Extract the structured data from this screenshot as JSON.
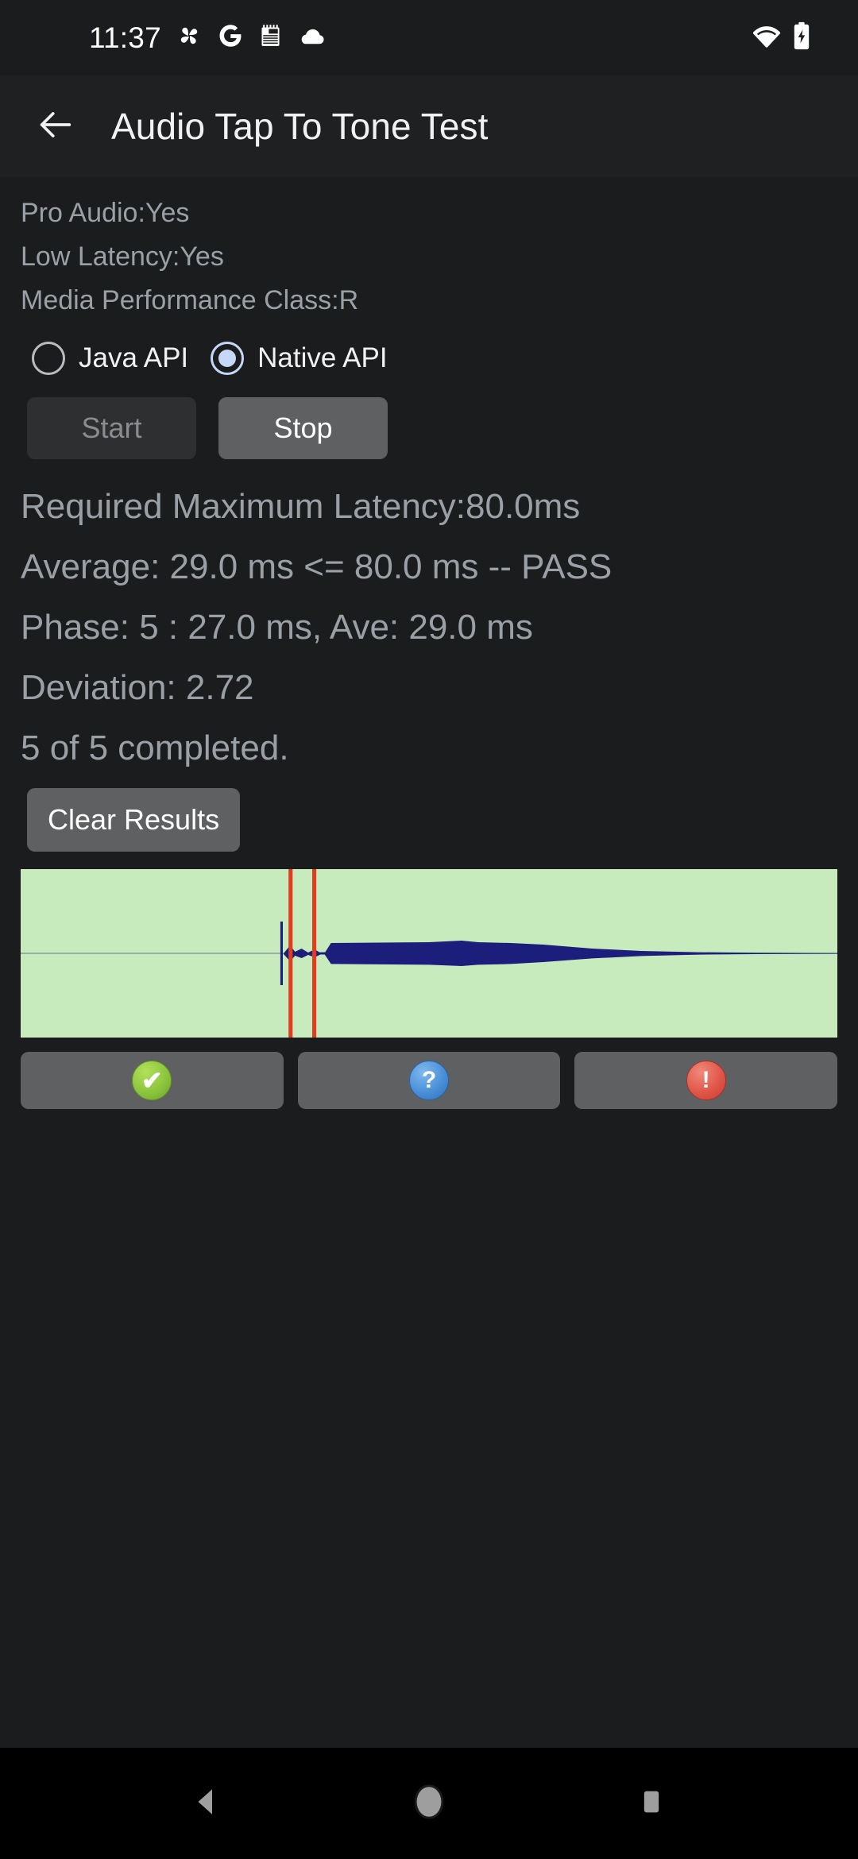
{
  "status_bar": {
    "time": "11:37",
    "left_icons": [
      "pinwheel-icon",
      "google-g-icon",
      "notepad-icon",
      "cloud-icon"
    ],
    "right_icons": [
      "wifi-icon",
      "battery-charging-icon"
    ]
  },
  "app_bar": {
    "back_icon": "back-arrow-icon",
    "title": "Audio Tap To Tone Test"
  },
  "info": {
    "lines": [
      "Pro Audio:Yes",
      "Low Latency:Yes",
      "Media Performance Class:R"
    ]
  },
  "api_selector": {
    "options": [
      {
        "label": "Java API",
        "selected": false
      },
      {
        "label": "Native API",
        "selected": true
      }
    ]
  },
  "controls": {
    "start_label": "Start",
    "start_enabled": false,
    "stop_label": "Stop",
    "stop_enabled": true,
    "clear_label": "Clear Results"
  },
  "results": {
    "lines": [
      "Required Maximum Latency:80.0ms",
      "Average: 29.0 ms <= 80.0 ms -- PASS",
      "Phase: 5 : 27.0 ms, Ave: 29.0 ms",
      "Deviation: 2.72",
      "5 of 5 completed."
    ]
  },
  "plot": {
    "background_color": "#c8ebbe",
    "waveform_color": "#1b1e7a",
    "cursor_color": "#e03c20",
    "cursor_positions_pct": [
      33.1,
      35.8
    ]
  },
  "verdict": {
    "pass_icon": "check-circle-icon",
    "info_icon": "question-circle-icon",
    "fail_icon": "exclamation-circle-icon",
    "pass_color": "#8cc63e",
    "info_color": "#4a90d9",
    "fail_color": "#e0574a"
  },
  "nav_bar": {
    "back_icon": "nav-back-triangle-icon",
    "home_icon": "nav-home-circle-icon",
    "recents_icon": "nav-recents-square-icon"
  }
}
